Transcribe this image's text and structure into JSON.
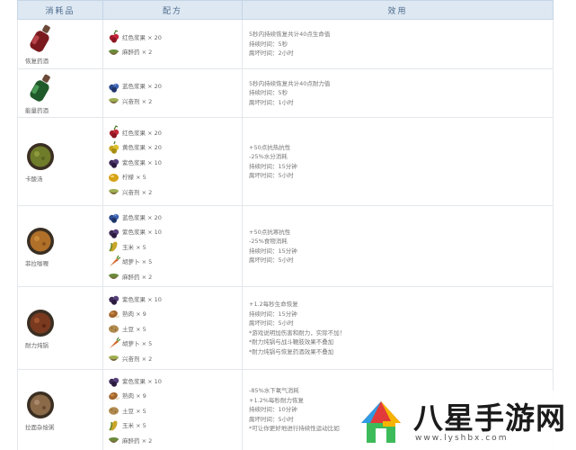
{
  "table": {
    "headers": [
      "消耗品",
      "配方",
      "效用"
    ],
    "rows": [
      {
        "item": {
          "name": "恢复药酒",
          "icon": "red-potion-bottle"
        },
        "ingredients": [
          {
            "label": "红色浆果 × 20",
            "icon": "red-berry"
          },
          {
            "label": "麻醉药 × 2",
            "icon": "narcotic-bowl"
          }
        ],
        "effects": [
          "5秒内持续恢复共计40点生命值",
          "持续时间：5秒",
          "腐坏时间：2小时"
        ]
      },
      {
        "item": {
          "name": "能量药酒",
          "icon": "green-potion-bottle"
        },
        "ingredients": [
          {
            "label": "蓝色浆果 × 20",
            "icon": "blue-berry"
          },
          {
            "label": "兴奋剂 × 2",
            "icon": "stimulant-bowl"
          }
        ],
        "effects": [
          "5秒内持续恢复共计40点耐力值",
          "持续时间：5秒",
          "腐坏时间：1小时"
        ]
      },
      {
        "item": {
          "name": "卡酸汤",
          "icon": "green-soup-bowl"
        },
        "ingredients": [
          {
            "label": "红色浆果 × 20",
            "icon": "red-berry"
          },
          {
            "label": "黄色浆果 × 20",
            "icon": "yellow-berry"
          },
          {
            "label": "紫色浆果 × 10",
            "icon": "purple-berry"
          },
          {
            "label": "柠檬 × 5",
            "icon": "lemon"
          },
          {
            "label": "兴奋剂 × 2",
            "icon": "stimulant-bowl"
          }
        ],
        "effects": [
          "+50点抗热抗性",
          "-25%水分消耗",
          "持续时间：15分钟",
          "腐坏时间：5小时"
        ]
      },
      {
        "item": {
          "name": "菲拉咖喱",
          "icon": "curry-bowl"
        },
        "ingredients": [
          {
            "label": "蓝色浆果 × 20",
            "icon": "blue-berry"
          },
          {
            "label": "紫色浆果 × 10",
            "icon": "purple-berry"
          },
          {
            "label": "玉米 × 5",
            "icon": "corn"
          },
          {
            "label": "胡萝卜 × 5",
            "icon": "carrot"
          },
          {
            "label": "麻醉药 × 2",
            "icon": "narcotic-bowl"
          }
        ],
        "effects": [
          "+50点抗寒抗性",
          "-25%食物消耗",
          "持续时间：15分钟",
          "腐坏时间：5小时"
        ]
      },
      {
        "item": {
          "name": "耐力炖锅",
          "icon": "stew-bowl"
        },
        "ingredients": [
          {
            "label": "紫色浆果 × 10",
            "icon": "purple-berry"
          },
          {
            "label": "熟肉 × 9",
            "icon": "cooked-meat"
          },
          {
            "label": "土豆 × 5",
            "icon": "potato"
          },
          {
            "label": "胡萝卜 × 5",
            "icon": "carrot"
          },
          {
            "label": "兴奋剂 × 2",
            "icon": "stimulant-bowl"
          }
        ],
        "effects": [
          "+1.2每秒生命恢复",
          "持续时间：15分钟",
          "腐坏时间：5小时",
          "*游戏说明加伤害和耐力，实际不加！",
          "*耐力炖锅与战斗鞭肢效果不叠加",
          "*耐力炖锅与恢复药酒效果不叠加"
        ]
      },
      {
        "item": {
          "name": "拉面杂烩粥",
          "icon": "porridge-bowl"
        },
        "ingredients": [
          {
            "label": "紫色浆果 × 10",
            "icon": "purple-berry"
          },
          {
            "label": "熟肉 × 9",
            "icon": "cooked-meat"
          },
          {
            "label": "土豆 × 5",
            "icon": "potato"
          },
          {
            "label": "玉米 × 5",
            "icon": "corn"
          },
          {
            "label": "麻醉药 × 2",
            "icon": "narcotic-bowl"
          }
        ],
        "effects": [
          "-85%水下氧气消耗",
          "+1.2%每秒耐力恢复",
          "持续时间：10分钟",
          "腐坏时间：5小时",
          "*可让你更好地进行持续性运动比如"
        ]
      }
    ]
  },
  "watermark": {
    "name": "八星手游网",
    "url": "www.lyshbx.com",
    "logo_icon": "colorful-house-logo"
  }
}
